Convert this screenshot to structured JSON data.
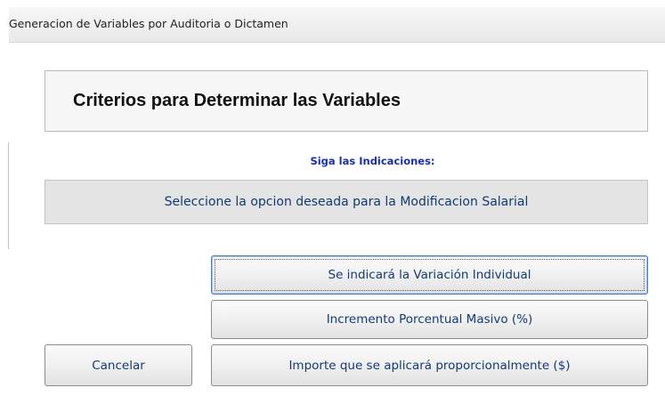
{
  "window": {
    "title": "Generacion de Variables por Auditoria o Dictamen"
  },
  "header": {
    "title": "Criterios para Determinar las Variables"
  },
  "instructions": {
    "label": "Siga las Indicaciones:"
  },
  "prompt": {
    "text": "Seleccione la opcion deseada para la Modificacion Salarial"
  },
  "options": {
    "individual_label": "Se indicará la Variación Individual",
    "porcentual_label": "Incremento Porcentual Masivo (%)",
    "importe_label": "Importe que se aplicará proporcionalmente ($)"
  },
  "actions": {
    "cancel_label": "Cancelar"
  },
  "colors": {
    "instructions_text": "#1a2fb0",
    "button_text": "#123a7a",
    "focus_border": "#3b7bd1"
  }
}
